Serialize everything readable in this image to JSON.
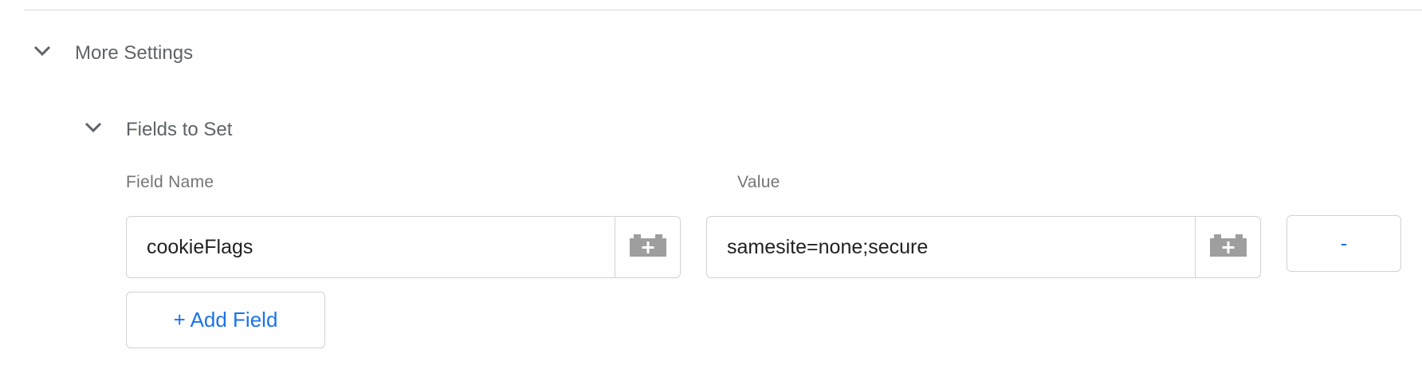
{
  "more_settings": {
    "title": "More Settings",
    "chevron_icon": "chevron-down-icon"
  },
  "fields_to_set": {
    "title": "Fields to Set",
    "chevron_icon": "chevron-down-icon",
    "columns": {
      "field_name_label": "Field Name",
      "value_label": "Value"
    },
    "rows": [
      {
        "field_name": "cookieFlags",
        "value": "samesite=none;secure",
        "field_name_variable_icon": "variable-picker-icon",
        "value_variable_icon": "variable-picker-icon",
        "remove_label": "-"
      }
    ],
    "add_field_label": "+ Add Field"
  },
  "colors": {
    "accent": "#1a73e8",
    "title_gray": "#5f6368",
    "label_gray": "#757575",
    "border": "#d2d2d2",
    "icon_gray": "#9e9e9e"
  }
}
